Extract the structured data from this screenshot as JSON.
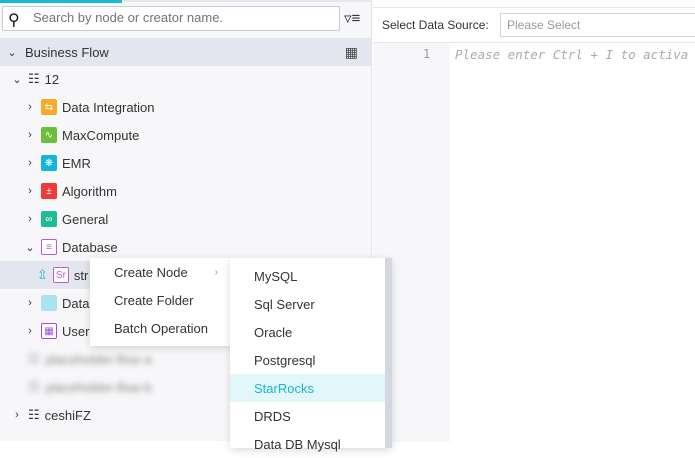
{
  "search": {
    "placeholder": "Search by node or creator name."
  },
  "tree": {
    "root": "Business Flow",
    "flow": "12",
    "items": [
      {
        "label": "Data Integration",
        "icon": "data-integration-icon",
        "color": "#f7a928"
      },
      {
        "label": "MaxCompute",
        "icon": "maxcompute-icon",
        "color": "#6cbf3a"
      },
      {
        "label": "EMR",
        "icon": "emr-icon",
        "color": "#15b4dc"
      },
      {
        "label": "Algorithm",
        "icon": "algorithm-icon",
        "color": "#ee3a3a"
      },
      {
        "label": "General",
        "icon": "general-icon",
        "color": "#1fba96"
      },
      {
        "label": "Database",
        "icon": "database-icon",
        "color": "#c158d6"
      }
    ],
    "node": {
      "badge": "Sr",
      "label": "str"
    },
    "after": [
      {
        "label": "DataC",
        "icon": "folder-icon",
        "color": "#a9e3f0"
      },
      {
        "label": "UserD",
        "icon": "user-defined-icon",
        "color": "#9a4ce0"
      }
    ],
    "blurred": [
      "placeholder-flow-a",
      "placeholder-flow-b"
    ],
    "flow2": "ceshiFZ"
  },
  "datasource": {
    "label": "Select Data Source:",
    "placeholder": "Please Select"
  },
  "editor": {
    "line": "1",
    "hint": "Please enter Ctrl + I to activa"
  },
  "context_menu": [
    "Create Node",
    "Create Folder",
    "Batch Operation"
  ],
  "submenu": [
    "MySQL",
    "Sql Server",
    "Oracle",
    "Postgresql",
    "StarRocks",
    "DRDS",
    "Data DB Mysql"
  ],
  "submenu_highlight": "StarRocks"
}
